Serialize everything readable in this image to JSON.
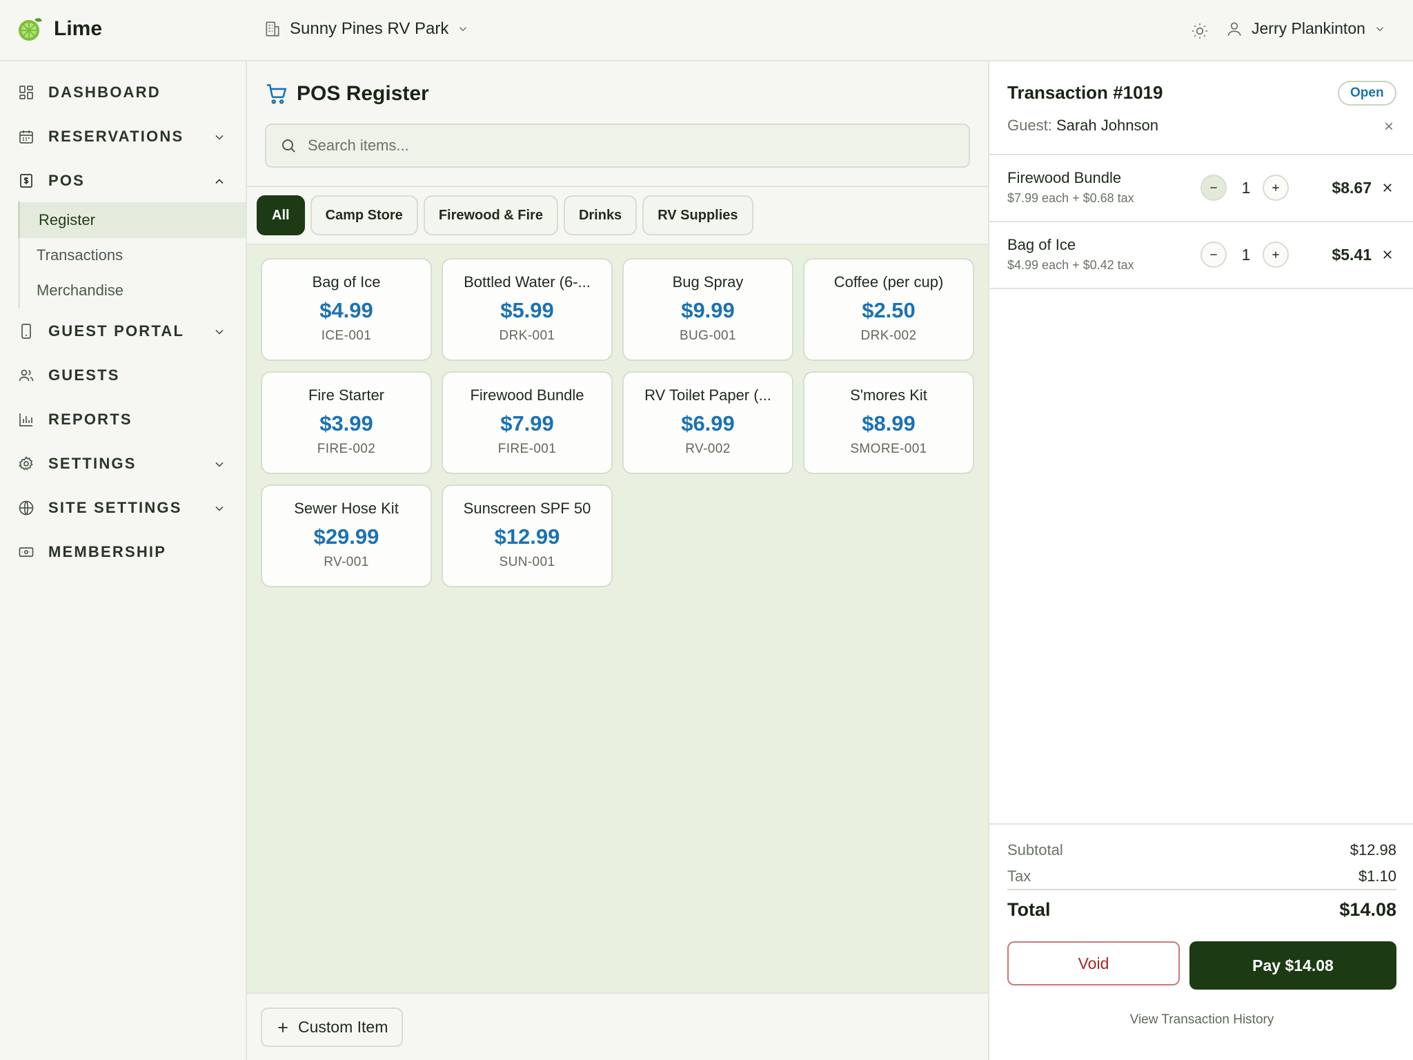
{
  "app": {
    "name": "Lime",
    "accent": "#1c3a14",
    "price_color": "#1b72b3"
  },
  "header": {
    "park": "Sunny Pines RV Park",
    "user": "Jerry Plankinton"
  },
  "sidebar": {
    "items": [
      {
        "label": "DASHBOARD",
        "icon": "dashboard-icon"
      },
      {
        "label": "RESERVATIONS",
        "icon": "calendar-icon"
      },
      {
        "label": "POS",
        "icon": "receipt-icon"
      },
      {
        "label": "GUEST PORTAL",
        "icon": "phone-icon"
      },
      {
        "label": "GUESTS",
        "icon": "users-icon"
      },
      {
        "label": "REPORTS",
        "icon": "bar-chart-icon"
      },
      {
        "label": "SETTINGS",
        "icon": "gear-icon"
      },
      {
        "label": "SITE SETTINGS",
        "icon": "globe-icon"
      },
      {
        "label": "MEMBERSHIP",
        "icon": "membership-card-icon"
      }
    ],
    "pos_sub": [
      "Register",
      "Transactions",
      "Merchandise"
    ],
    "active_sub": "Register"
  },
  "main": {
    "title": "POS Register",
    "search_placeholder": "Search items...",
    "filters": [
      "All",
      "Camp Store",
      "Firewood & Fire",
      "Drinks",
      "RV Supplies"
    ],
    "active_filter": "All",
    "products": [
      {
        "name": "Bag of Ice",
        "price": "$4.99",
        "sku": "ICE-001"
      },
      {
        "name": "Bottled Water (6-...",
        "price": "$5.99",
        "sku": "DRK-001"
      },
      {
        "name": "Bug Spray",
        "price": "$9.99",
        "sku": "BUG-001"
      },
      {
        "name": "Coffee (per cup)",
        "price": "$2.50",
        "sku": "DRK-002"
      },
      {
        "name": "Fire Starter",
        "price": "$3.99",
        "sku": "FIRE-002"
      },
      {
        "name": "Firewood Bundle",
        "price": "$7.99",
        "sku": "FIRE-001"
      },
      {
        "name": "RV Toilet Paper (...",
        "price": "$6.99",
        "sku": "RV-002"
      },
      {
        "name": "S'mores Kit",
        "price": "$8.99",
        "sku": "SMORE-001"
      },
      {
        "name": "Sewer Hose Kit",
        "price": "$29.99",
        "sku": "RV-001"
      },
      {
        "name": "Sunscreen SPF 50",
        "price": "$12.99",
        "sku": "SUN-001"
      }
    ],
    "custom_item": "Custom Item"
  },
  "transaction": {
    "title": "Transaction #1019",
    "status": "Open",
    "guest_label": "Guest:",
    "guest_name": "Sarah Johnson",
    "lines": [
      {
        "name": "Firewood Bundle",
        "detail": "$7.99 each + $0.68 tax",
        "qty": "1",
        "total": "$8.67"
      },
      {
        "name": "Bag of Ice",
        "detail": "$4.99 each + $0.42 tax",
        "qty": "1",
        "total": "$5.41"
      }
    ],
    "subtotal_label": "Subtotal",
    "subtotal": "$12.98",
    "tax_label": "Tax",
    "tax": "$1.10",
    "total_label": "Total",
    "total": "$14.08",
    "void_label": "Void",
    "pay_label": "Pay $14.08",
    "history_label": "View Transaction History"
  }
}
